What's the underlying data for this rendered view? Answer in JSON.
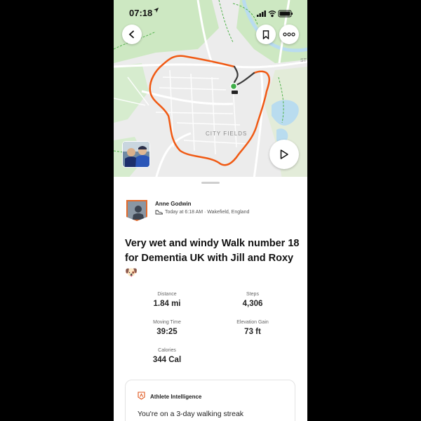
{
  "status_bar": {
    "time": "07:18",
    "location_icon": "navigation-arrow-icon",
    "signal_icon": "cellular-signal-icon",
    "wifi_icon": "wifi-icon",
    "battery_icon": "battery-icon"
  },
  "map": {
    "area_label": "CITY FIELDS",
    "street_label": "ST",
    "route_color": "#f05a14",
    "start_marker_color": "#3fae49",
    "buttons": {
      "back_icon": "chevron-left-icon",
      "bookmark_icon": "bookmark-icon",
      "more_icon": "more-dots-icon",
      "play_icon": "play-icon"
    }
  },
  "activity": {
    "athlete_name": "Anne Godwin",
    "type_icon": "walking-shoe-icon",
    "meta": "Today at 6:18 AM · Wakefield, England",
    "title": "Very wet and windy Walk number 18 for Dementia UK with Jill and Roxy 🐶",
    "stats": [
      {
        "label": "Distance",
        "value": "1.84 mi"
      },
      {
        "label": "Steps",
        "value": "4,306"
      },
      {
        "label": "Moving Time",
        "value": "39:25"
      },
      {
        "label": "Elevation Gain",
        "value": "73 ft"
      },
      {
        "label": "Calories",
        "value": "344 Cal"
      }
    ]
  },
  "intelligence": {
    "title": "Athlete Intelligence",
    "text": "You're on a 3-day walking streak"
  },
  "colors": {
    "brand": "#fc4c02",
    "map_green": "#cde8c2",
    "water": "#b9dcef"
  }
}
